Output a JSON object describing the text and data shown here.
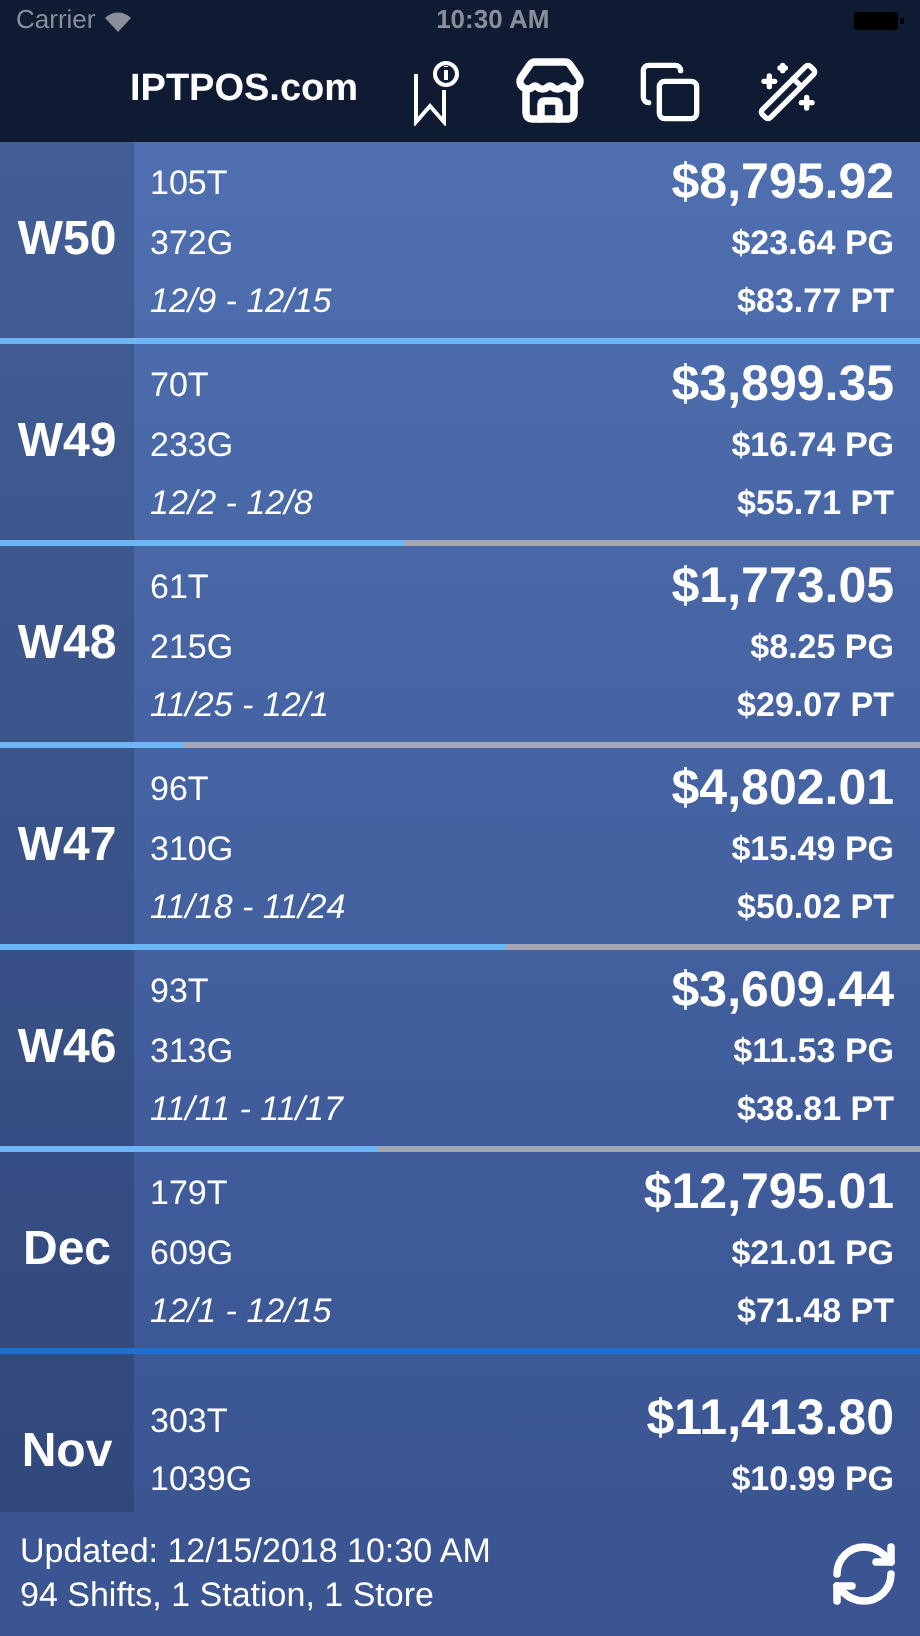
{
  "status_bar": {
    "carrier": "Carrier",
    "time": "10:30 AM"
  },
  "nav": {
    "title": "IPTPOS.com"
  },
  "rows": [
    {
      "kind": "week",
      "label": "W50",
      "transactions": "105T",
      "guests": "372G",
      "dates": "12/9 - 12/15",
      "total": "$8,795.92",
      "per_guest": "$23.64 PG",
      "per_transaction": "$83.77 PT",
      "level": 1
    },
    {
      "kind": "week",
      "label": "W49",
      "transactions": "70T",
      "guests": "233G",
      "dates": "12/2 - 12/8",
      "total": "$3,899.35",
      "per_guest": "$16.74 PG",
      "per_transaction": "$55.71 PT",
      "level": 0.44
    },
    {
      "kind": "week",
      "label": "W48",
      "transactions": "61T",
      "guests": "215G",
      "dates": "11/25 - 12/1",
      "total": "$1,773.05",
      "per_guest": "$8.25 PG",
      "per_transaction": "$29.07 PT",
      "level": 0.2
    },
    {
      "kind": "week",
      "label": "W47",
      "transactions": "96T",
      "guests": "310G",
      "dates": "11/18 - 11/24",
      "total": "$4,802.01",
      "per_guest": "$15.49 PG",
      "per_transaction": "$50.02 PT",
      "level": 0.55
    },
    {
      "kind": "week",
      "label": "W46",
      "transactions": "93T",
      "guests": "313G",
      "dates": "11/11 - 11/17",
      "total": "$3,609.44",
      "per_guest": "$11.53 PG",
      "per_transaction": "$38.81 PT",
      "level": 0.41
    },
    {
      "kind": "month",
      "label": "Dec",
      "transactions": "179T",
      "guests": "609G",
      "dates": "12/1 - 12/15",
      "total": "$12,795.01",
      "per_guest": "$21.01 PG",
      "per_transaction": "$71.48 PT",
      "level": 1
    },
    {
      "kind": "month",
      "label": "Nov",
      "transactions": "303T",
      "guests": "1039G",
      "total": "$11,413.80",
      "per_guest": "$10.99 PG"
    }
  ],
  "footer": {
    "updated": "Updated: 12/15/2018 10:30 AM",
    "summary": "94 Shifts, 1 Station, 1 Store"
  }
}
